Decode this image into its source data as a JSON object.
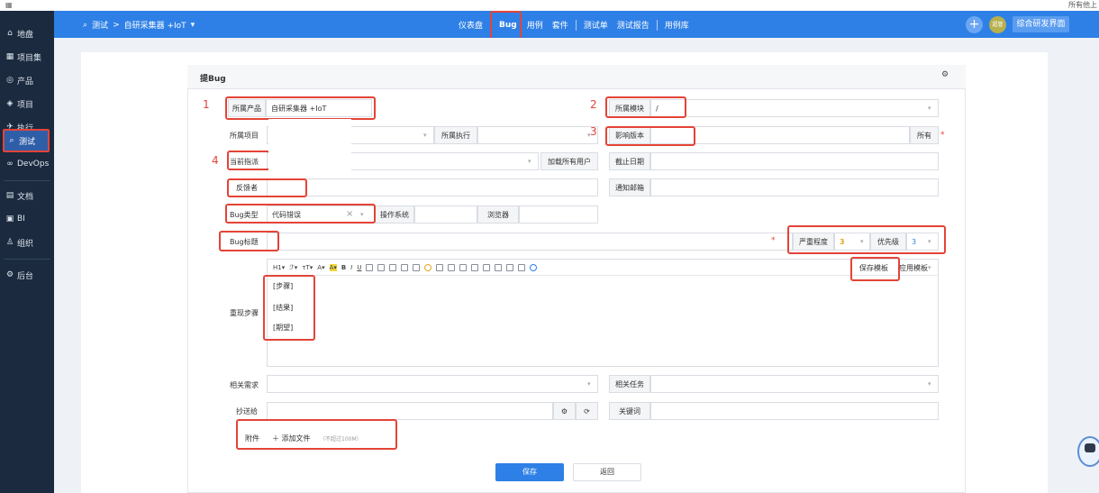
{
  "window": {
    "icon": "grid-icon",
    "right_text": "所有他上"
  },
  "sidebar": {
    "items": [
      {
        "icon": "⌂",
        "label": "地盘"
      },
      {
        "icon": "▦",
        "label": "项目集"
      },
      {
        "icon": "◎",
        "label": "产品"
      },
      {
        "icon": "◈",
        "label": "项目"
      },
      {
        "icon": "✈",
        "label": "执行"
      },
      {
        "icon": "⌕",
        "label": "测试"
      },
      {
        "icon": "∞",
        "label": "DevOps"
      },
      {
        "icon": "▤",
        "label": "文档"
      },
      {
        "icon": "▣",
        "label": "BI"
      },
      {
        "icon": "♙",
        "label": "组织"
      },
      {
        "icon": "⚙",
        "label": "后台"
      }
    ]
  },
  "header": {
    "breadcrumb": {
      "module": "测试",
      "arrow": ">",
      "product": "自研采集器 +IoT",
      "caret": "▾"
    },
    "nav": [
      "仪表盘",
      "Bug",
      "用例",
      "套件",
      "测试单",
      "测试报告",
      "用例库"
    ],
    "avatar_text": "超管",
    "switch_button": "综合研发界面"
  },
  "form": {
    "title": "提Bug",
    "product_label": "所属产品",
    "product_value": "自研采集器 +IoT",
    "module_label": "所属模块",
    "module_value": "/",
    "project_label": "所属项目",
    "execution_label": "所属执行",
    "build_label": "影响版本",
    "build_all": "所有",
    "assign_label": "当前指派",
    "load_users": "加载所有用户",
    "deadline_label": "截止日期",
    "feedback_label": "反馈者",
    "notify_label": "通知邮箱",
    "type_label": "Bug类型",
    "type_value": "代码错误",
    "clear_x": "×",
    "os_label": "操作系统",
    "browser_label": "浏览器",
    "title_label": "Bug标题",
    "severity_label": "严重程度",
    "severity_value": "3",
    "priority_label": "优先级",
    "priority_value": "3",
    "steps_label": "重现步骤",
    "toolbar": [
      "H1▾",
      "ℱ▾",
      "τT▾",
      "A▾",
      "A▾",
      "B",
      "I",
      "U"
    ],
    "save_template": "保存模板",
    "apply_template": "应用模板",
    "steps_lines": [
      "[步骤]",
      "[结果]",
      "[期望]"
    ],
    "story_label": "相关需求",
    "task_label": "相关任务",
    "cc_label": "抄送给",
    "keyword_label": "关键词",
    "files_label": "附件",
    "add_file": "＋ 添加文件",
    "file_hint": "（不超过100M）",
    "save_button": "保存",
    "back_button": "返回"
  },
  "annotations": [
    "1",
    "2",
    "3",
    "4"
  ],
  "colors": {
    "header": "#2e80e6",
    "sidebar": "#1b2a3f",
    "highlight": "#e34437"
  }
}
